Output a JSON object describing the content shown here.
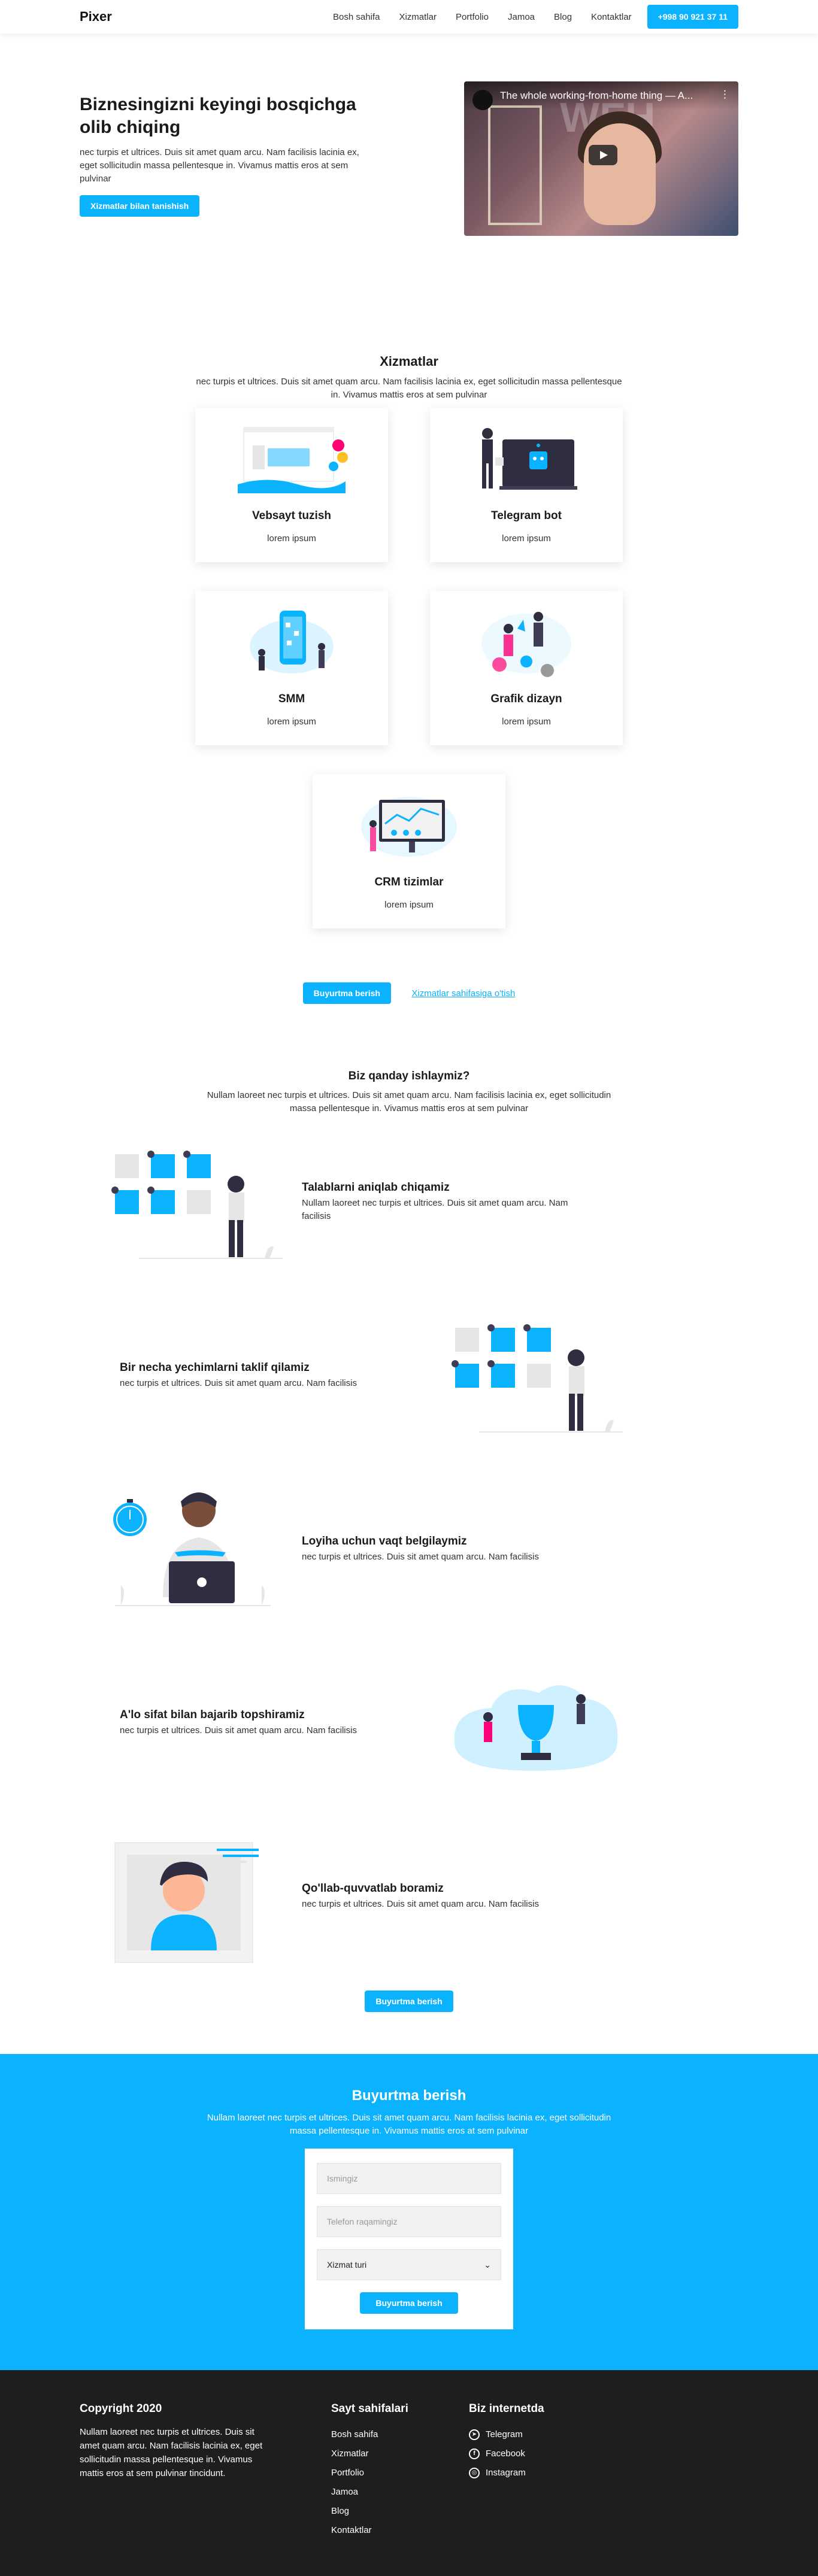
{
  "header": {
    "logo": "Pixer",
    "nav": [
      "Bosh sahifa",
      "Xizmatlar",
      "Portfolio",
      "Jamoa",
      "Blog",
      "Kontaktlar"
    ],
    "phone": "+998 90 921 37 11"
  },
  "hero": {
    "title": "Biznesingizni keyingi bosqichga olib chiqing",
    "text": "nec turpis et ultrices. Duis sit amet quam arcu. Nam facilisis lacinia ex, eget sollicitudin massa pellentesque in. Vivamus mattis eros at sem pulvinar",
    "button": "Xizmatlar bilan tanishish",
    "video_title": "The whole working-from-home thing — A...",
    "video_overlay": "WFH"
  },
  "services": {
    "title": "Xizmatlar",
    "subtitle": "nec turpis et ultrices. Duis sit amet quam arcu. Nam facilisis lacinia ex, eget sollicitudin massa pellentesque in. Vivamus mattis eros at sem pulvinar",
    "cards": [
      {
        "title": "Vebsayt tuzish",
        "text": "lorem ipsum",
        "icon": "website-illustration"
      },
      {
        "title": "Telegram bot",
        "text": "lorem ipsum",
        "icon": "bot-illustration"
      },
      {
        "title": "SMM",
        "text": "lorem ipsum",
        "icon": "smm-illustration"
      },
      {
        "title": "Grafik dizayn",
        "text": "lorem ipsum",
        "icon": "design-illustration"
      },
      {
        "title": "CRM tizimlar",
        "text": "lorem ipsum",
        "icon": "crm-illustration"
      }
    ],
    "order_button": "Buyurtma berish",
    "services_link": "Xizmatlar sahifasiga o'tish"
  },
  "how": {
    "title": "Biz qanday ishlaymiz?",
    "subtitle": "Nullam laoreet nec turpis et ultrices. Duis sit amet quam arcu. Nam facilisis lacinia ex, eget sollicitudin massa pellentesque in. Vivamus mattis eros at sem pulvinar",
    "steps": [
      {
        "title": "Talablarni aniqlab chiqamiz",
        "text": "Nullam laoreet nec turpis et ultrices. Duis sit amet quam arcu. Nam facilisis"
      },
      {
        "title": "Bir necha yechimlarni taklif qilamiz",
        "text": "nec turpis et ultrices. Duis sit amet quam arcu. Nam facilisis"
      },
      {
        "title": "Loyiha uchun vaqt belgilaymiz",
        "text": "nec turpis et ultrices. Duis sit amet quam arcu. Nam facilisis"
      },
      {
        "title": "A'lo sifat bilan bajarib topshiramiz",
        "text": "nec turpis et ultrices. Duis sit amet quam arcu. Nam facilisis"
      },
      {
        "title": "Qo'llab-quvvatlab boramiz",
        "text": "nec turpis et ultrices. Duis sit amet quam arcu. Nam facilisis"
      }
    ],
    "button": "Buyurtma berish"
  },
  "order": {
    "title": "Buyurtma berish",
    "subtitle": "Nullam laoreet nec turpis et ultrices. Duis sit amet quam arcu. Nam facilisis lacinia ex, eget sollicitudin massa pellentesque in. Vivamus mattis eros at sem pulvinar",
    "name_placeholder": "Ismingiz",
    "phone_placeholder": "Telefon raqamingiz",
    "service_select": "Xizmat turi",
    "submit": "Buyurtma berish"
  },
  "footer": {
    "copyright_title": "Copyright 2020",
    "copyright_text": "Nullam laoreet nec turpis et ultrices. Duis sit amet quam arcu. Nam facilisis lacinia ex, eget sollicitudin massa pellentesque in. Vivamus mattis eros at sem pulvinar tincidunt.",
    "pages_title": "Sayt sahifalari",
    "pages": [
      "Bosh sahifa",
      "Xizmatlar",
      "Portfolio",
      "Jamoa",
      "Blog",
      "Kontaktlar"
    ],
    "social_title": "Biz internetda",
    "social": [
      {
        "label": "Telegram",
        "icon": "telegram-icon"
      },
      {
        "label": "Facebook",
        "icon": "facebook-icon"
      },
      {
        "label": "Instagram",
        "icon": "instagram-icon"
      }
    ]
  },
  "colors": {
    "accent": "#0bb3ff",
    "footer_bg": "#1e1e1e",
    "dark": "#2f2e41"
  }
}
